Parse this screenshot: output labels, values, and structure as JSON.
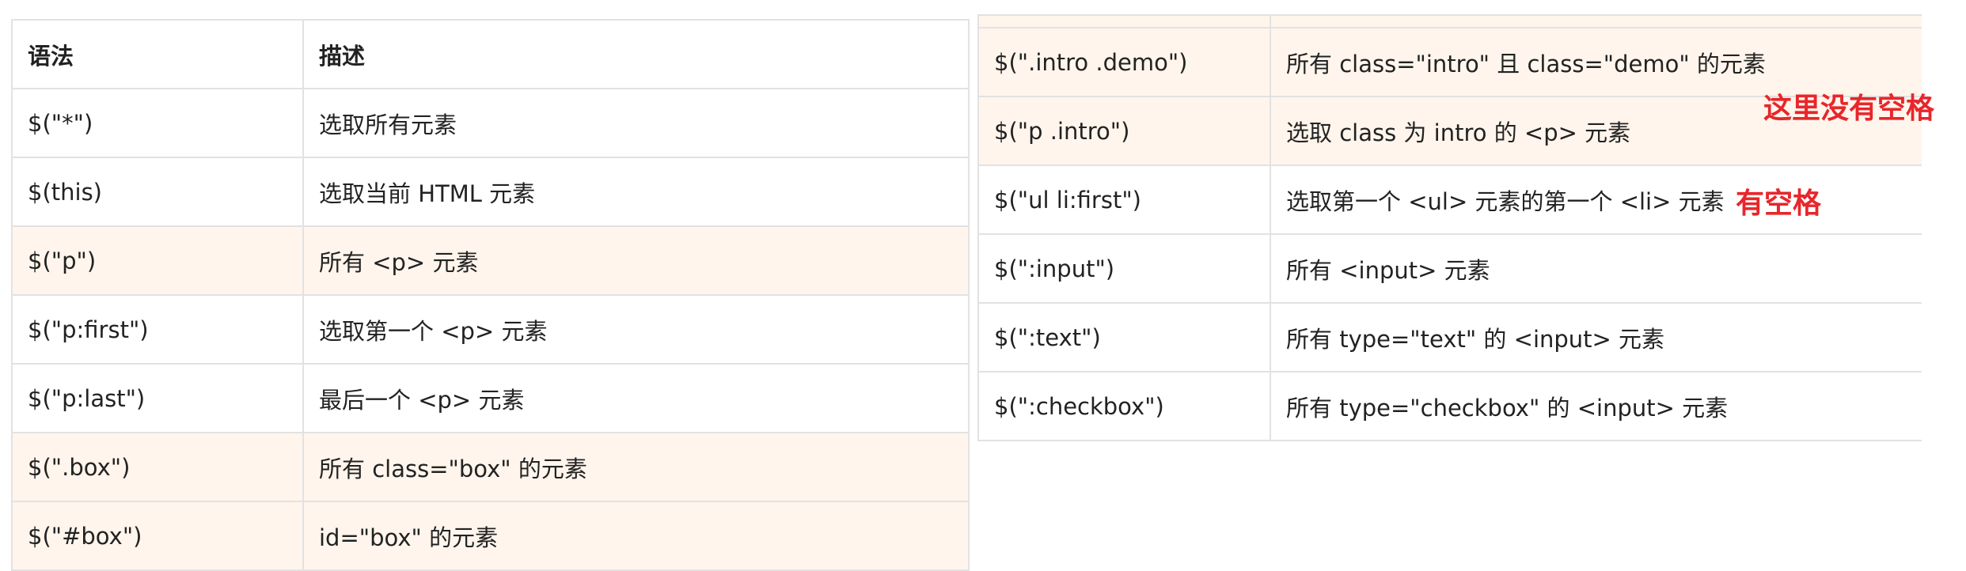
{
  "left_table": {
    "headers": [
      "语法",
      "描述"
    ],
    "rows": [
      {
        "syntax": "$(\"*\")",
        "desc": "选取所有元素"
      },
      {
        "syntax": "$(this)",
        "desc": "选取当前 HTML 元素"
      },
      {
        "syntax": "$(\"p\")",
        "desc": "所有 <p> 元素"
      },
      {
        "syntax": "$(\"p:first\")",
        "desc": "选取第一个 <p> 元素"
      },
      {
        "syntax": "$(\"p:last\")",
        "desc": "最后一个 <p> 元素"
      },
      {
        "syntax": "$(\".box\")",
        "desc": "所有 class=\"box\" 的元素"
      },
      {
        "syntax": "$(\"#box\")",
        "desc": "id=\"box\" 的元素"
      }
    ]
  },
  "right_table": {
    "rows": [
      {
        "syntax": "$(\".intro .demo\")",
        "desc": "所有 class=\"intro\" 且 class=\"demo\" 的元素"
      },
      {
        "syntax": "$(\"p .intro\")",
        "desc": "选取 class 为 intro 的 <p> 元素"
      },
      {
        "syntax": "$(\"ul li:first\")",
        "desc": "选取第一个 <ul> 元素的第一个 <li> 元素"
      },
      {
        "syntax": "$(\":input\")",
        "desc": "所有 <input> 元素"
      },
      {
        "syntax": "$(\":text\")",
        "desc": "所有 type=\"text\" 的 <input> 元素"
      },
      {
        "syntax": "$(\":checkbox\")",
        "desc": "所有 type=\"checkbox\" 的 <input> 元素"
      }
    ]
  },
  "annotations": {
    "no_space": "这里没有空格",
    "has_space": "有空格",
    "color": "#e8262b"
  },
  "colors": {
    "alt_row": "#fff5ec",
    "border": "#e2e2e2",
    "text": "#222222"
  }
}
